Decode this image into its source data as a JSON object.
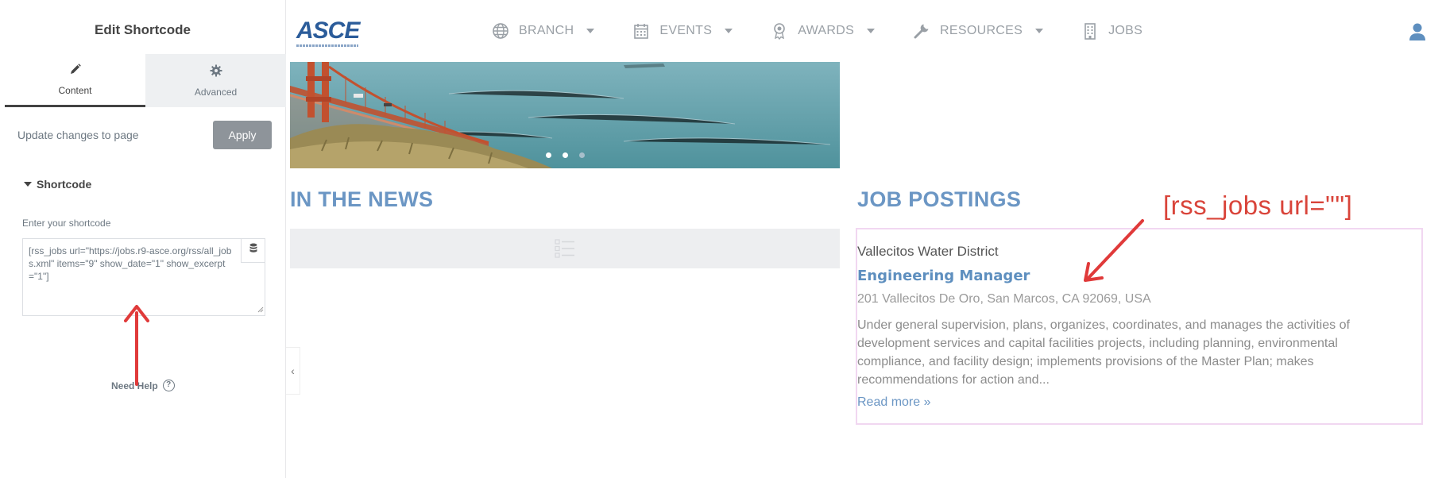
{
  "editor": {
    "title": "Edit Shortcode",
    "tabs": [
      {
        "label": "Content",
        "icon": "pencil-icon",
        "active": true
      },
      {
        "label": "Advanced",
        "icon": "gear-icon",
        "active": false
      }
    ],
    "update_label": "Update changes to page",
    "apply_label": "Apply",
    "section_label": "Shortcode",
    "field_label": "Enter your shortcode",
    "shortcode_value": "[rss_jobs url=\"https://jobs.r9-asce.org/rss/all_jobs.xml\" items=\"9\" show_date=\"1\" show_excerpt=\"1\"]",
    "help_label": "Need Help",
    "help_glyph": "?",
    "collapse_glyph": "‹"
  },
  "site": {
    "logo": "ASCE",
    "nav": [
      {
        "label": "BRANCH",
        "icon": "globe-icon",
        "dropdown": true
      },
      {
        "label": "EVENTS",
        "icon": "calendar-icon",
        "dropdown": true
      },
      {
        "label": "AWARDS",
        "icon": "award-icon",
        "dropdown": true
      },
      {
        "label": "RESOURCES",
        "icon": "wrench-icon",
        "dropdown": true
      },
      {
        "label": "JOBS",
        "icon": "building-icon",
        "dropdown": false
      }
    ],
    "news_title": "IN THE NEWS",
    "jobs_title": "JOB POSTINGS",
    "job": {
      "company": "Vallecitos Water District",
      "title": "Engineering Manager",
      "address": "201 Vallecitos De Oro, San Marcos, CA 92069, USA",
      "description": "Under general supervision, plans, organizes, coordinates, and manages the activities of development services and capital facilities projects, including planning, environmental compliance, and facility design; implements provisions of the Master Plan; makes recommendations for action and...",
      "read_more": "Read more »"
    }
  },
  "annotation": {
    "text": "[rss_jobs url=\"\"]",
    "color": "#d9443a"
  },
  "colors": {
    "accent": "#6b96c4",
    "logo": "#2b5c9a",
    "apply_button": "#8e949a",
    "job_border": "#f1d7f1"
  }
}
